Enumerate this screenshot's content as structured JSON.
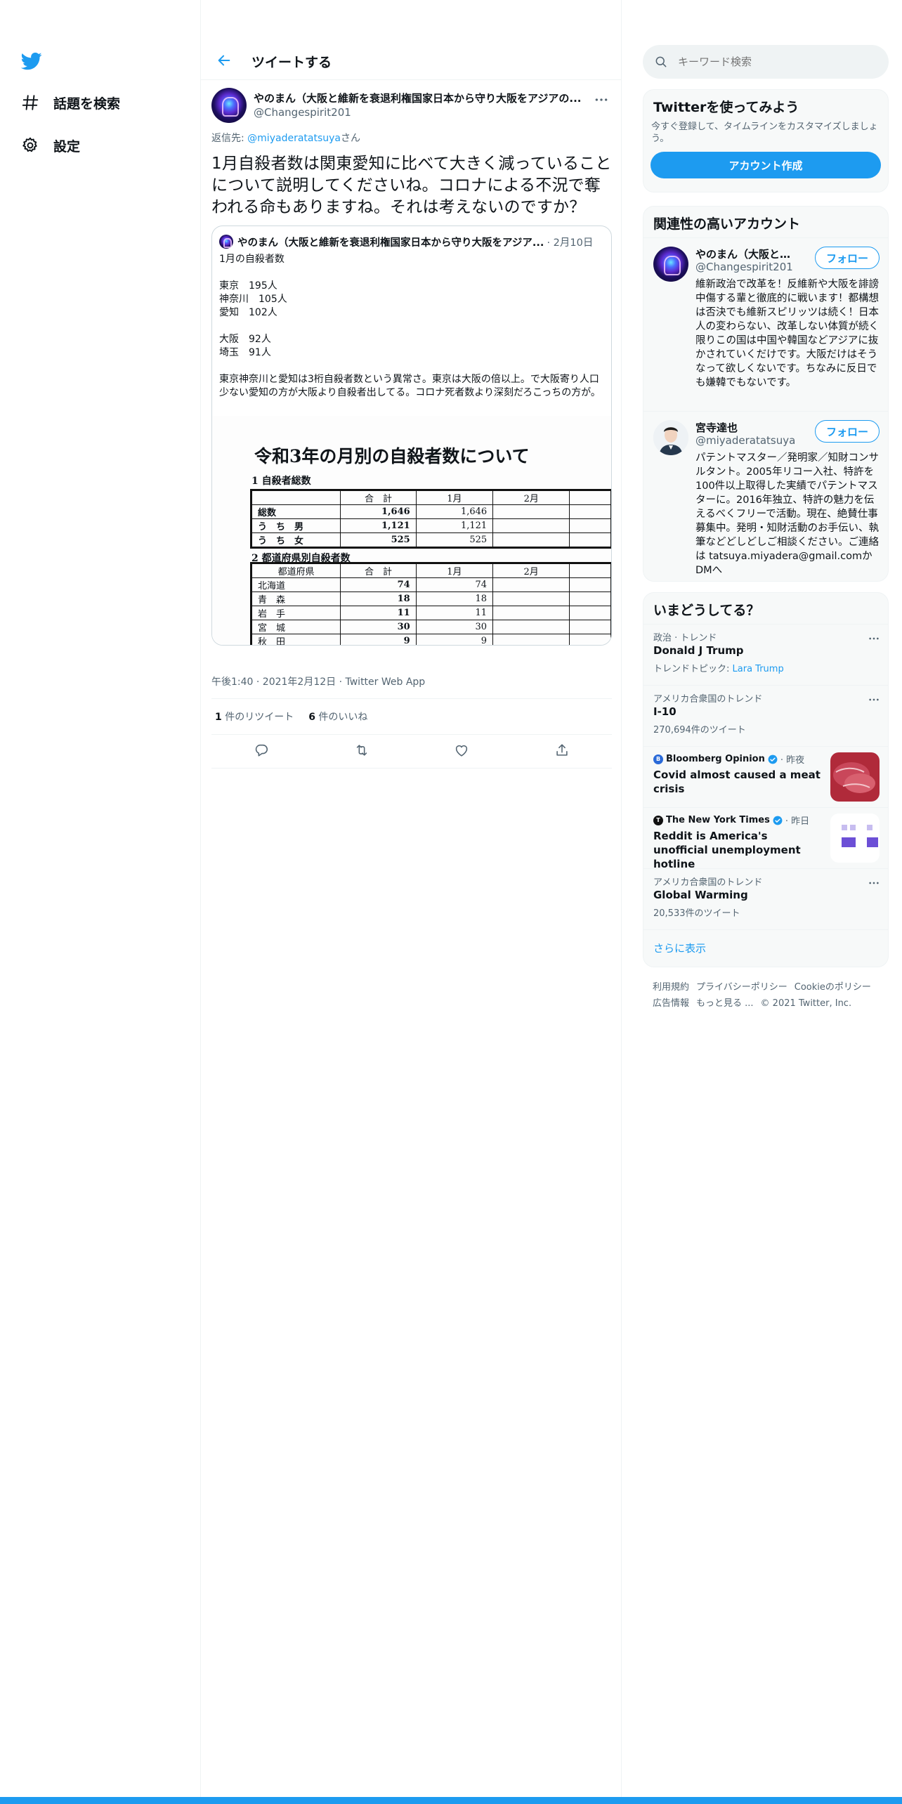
{
  "nav": {
    "explore_label": "話題を検索",
    "settings_label": "設定"
  },
  "header": {
    "title": "ツイートする"
  },
  "tweet": {
    "author_name": "やのまん（大阪と維新を衰退利権国家日本から守り大阪をアジアの...",
    "author_handle": "@Changespirit201",
    "reply_prefix": "返信先: ",
    "reply_handle": "@miyaderatatsuya",
    "reply_suffix": "さん",
    "text": "1月自殺者数は関東愛知に比べて大きく減っていることについて説明してくださいね。コロナによる不況で奪われる命もありますね。それは考えないのですか？",
    "time": "午後1:40 · 2021年2月12日 · Twitter Web App",
    "retweet_count": "1",
    "retweet_label": " 件のリツイート",
    "like_count": "6",
    "like_label": " 件のいいね"
  },
  "quote": {
    "author_name": "やのまん（大阪と維新を衰退利権国家日本から守り大阪をアジア...",
    "date": "· 2月10日",
    "text": "1月の自殺者数\n\n東京　195人\n神奈川　105人\n愛知　102人\n\n大阪　92人\n埼玉　91人\n\n東京神奈川と愛知は3桁自殺者数という異常さ。東京は大阪の倍以上。で大阪寄り人口少ない愛知の方が大阪より自殺者出してる。コロナ死者数より深刻だろこっちの方が。",
    "image": {
      "title": "令和3年の月別の自殺者数について",
      "section1": "1  自殺者総数",
      "section2": "2  都道府県別自殺者数",
      "table1_header": [
        "",
        "合　計",
        "1月",
        "2月",
        ""
      ],
      "table1_rows": [
        [
          "総数",
          "1,646",
          "1,646",
          "",
          ""
        ],
        [
          "う　ち　男",
          "1,121",
          "1,121",
          "",
          ""
        ],
        [
          "う　ち　女",
          "525",
          "525",
          "",
          ""
        ]
      ],
      "table2_header": [
        "都道府県",
        "合　計",
        "1月",
        "2月",
        ""
      ],
      "table2_rows": [
        [
          "北海道",
          "74",
          "74",
          "",
          ""
        ],
        [
          "青　森",
          "18",
          "18",
          "",
          ""
        ],
        [
          "岩　手",
          "11",
          "11",
          "",
          ""
        ],
        [
          "宮　城",
          "30",
          "30",
          "",
          ""
        ],
        [
          "秋　田",
          "9",
          "9",
          "",
          ""
        ]
      ]
    }
  },
  "search": {
    "placeholder": "キーワード検索"
  },
  "signup": {
    "title": "Twitterを使ってみよう",
    "desc": "今すぐ登録して、タイムラインをカスタマイズしましょう。",
    "button": "アカウント作成"
  },
  "accounts": {
    "title": "関連性の高いアカウント",
    "follow_label": "フォロー",
    "items": [
      {
        "name": "やのまん（大阪と維新を衰退利権国家日本から守り大阪をアジアの",
        "handle": "@Changespirit201",
        "bio": "維新政治で改革を！反維新や大阪を誹謗中傷する輩と徹底的に戦います！都構想は否決でも維新スピリッツは続く！日本人の変わらない、改革しない体質が続く限りこの国は中国や韓国などアジアに抜かされていくだけです。大阪だけはそうなって欲しくないです。ちなみに反日でも嫌韓でもないです。"
      },
      {
        "name": "宮寺達也",
        "handle": "@miyaderatatsuya",
        "bio": "パテントマスター／発明家／知財コンサルタント。2005年リコー入社、特許を100件以上取得した実績でパテントマスターに。2016年独立、特許の魅力を伝えるべくフリーで活動。現在、絶賛仕事募集中。発明・知財活動のお手伝い、執筆などどしどしご相談ください。ご連絡は tatsuya.miyadera@gmail.comかDMへ"
      }
    ]
  },
  "trends": {
    "title": "いまどうしてる？",
    "show_more": "さらに表示",
    "items": [
      {
        "meta": "政治 · トレンド",
        "name": "Donald J Trump",
        "sub_prefix": "トレンドトピック: ",
        "sub_link": "Lara Trump"
      },
      {
        "meta": "アメリカ合衆国のトレンド",
        "name": "I-10",
        "sub": "270,694件のツイート"
      },
      {
        "source": "Bloomberg Opinion",
        "time": "· 昨夜",
        "title": "Covid almost caused a meat crisis"
      },
      {
        "source": "The New York Times",
        "time": "· 昨日",
        "title": "Reddit is America's unofficial unemployment hotline"
      },
      {
        "meta": "アメリカ合衆国のトレンド",
        "name": "Global Warming",
        "sub": "20,533件のツイート"
      }
    ]
  },
  "footer": {
    "links": [
      "利用規約",
      "プライバシーポリシー",
      "Cookieのポリシー",
      "広告情報",
      "もっと見る ...",
      "© 2021 Twitter, Inc."
    ]
  },
  "colors": {
    "accent": "#1d9bf0",
    "text": "#0f1419",
    "secondary": "#536471",
    "border": "#eff3f4"
  }
}
